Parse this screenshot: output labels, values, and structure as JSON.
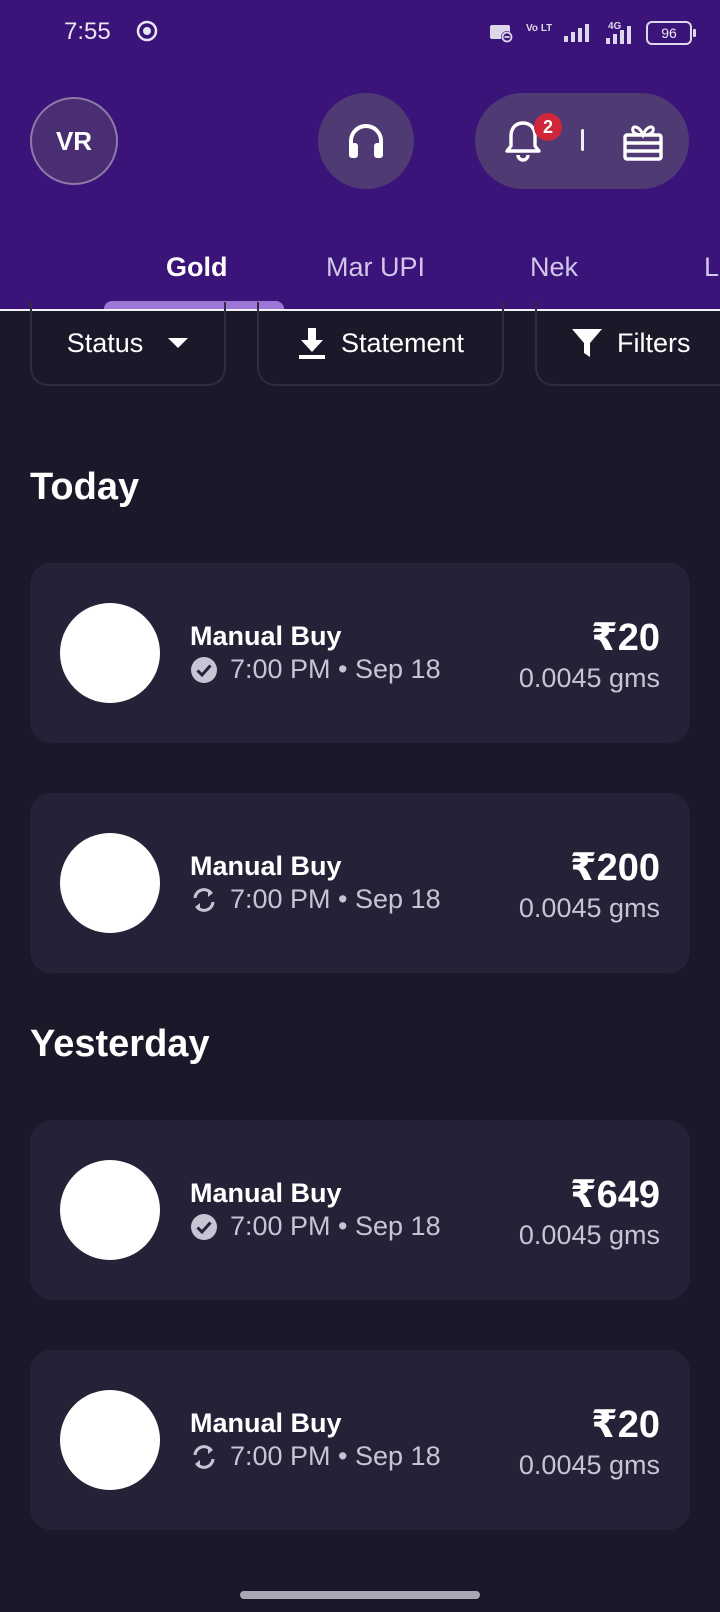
{
  "status_bar": {
    "time": "7:55",
    "volte": "Vo LTE2",
    "network": "4G",
    "battery": "96"
  },
  "header": {
    "avatar_initials": "VR",
    "notification_count": "2"
  },
  "tabs": [
    {
      "label": "Gold",
      "active": true
    },
    {
      "label": "Mar UPI",
      "active": false
    },
    {
      "label": "Nek",
      "active": false
    },
    {
      "label": "L",
      "active": false
    }
  ],
  "filters": {
    "status_label": "Status",
    "statement_label": "Statement",
    "filters_label": "Filters"
  },
  "sections": [
    {
      "title": "Today",
      "transactions": [
        {
          "title": "Manual Buy",
          "status_icon": "check-circle-icon",
          "meta": "7:00 PM • Sep 18",
          "amount": "₹20",
          "quantity": "0.0045 gms"
        },
        {
          "title": "Manual Buy",
          "status_icon": "sync-icon",
          "meta": "7:00 PM • Sep 18",
          "amount": "₹200",
          "quantity": "0.0045 gms"
        }
      ]
    },
    {
      "title": "Yesterday",
      "transactions": [
        {
          "title": "Manual Buy",
          "status_icon": "check-circle-icon",
          "meta": "7:00 PM • Sep 18",
          "amount": "₹649",
          "quantity": "0.0045 gms"
        },
        {
          "title": "Manual Buy",
          "status_icon": "sync-icon",
          "meta": "7:00 PM • Sep 18",
          "amount": "₹20",
          "quantity": "0.0045 gms"
        }
      ]
    }
  ],
  "colors": {
    "header_bg": "#3a1478",
    "page_bg": "#1b1929",
    "card_bg": "#252238",
    "accent": "#9b77d6",
    "badge": "#d0263a"
  }
}
